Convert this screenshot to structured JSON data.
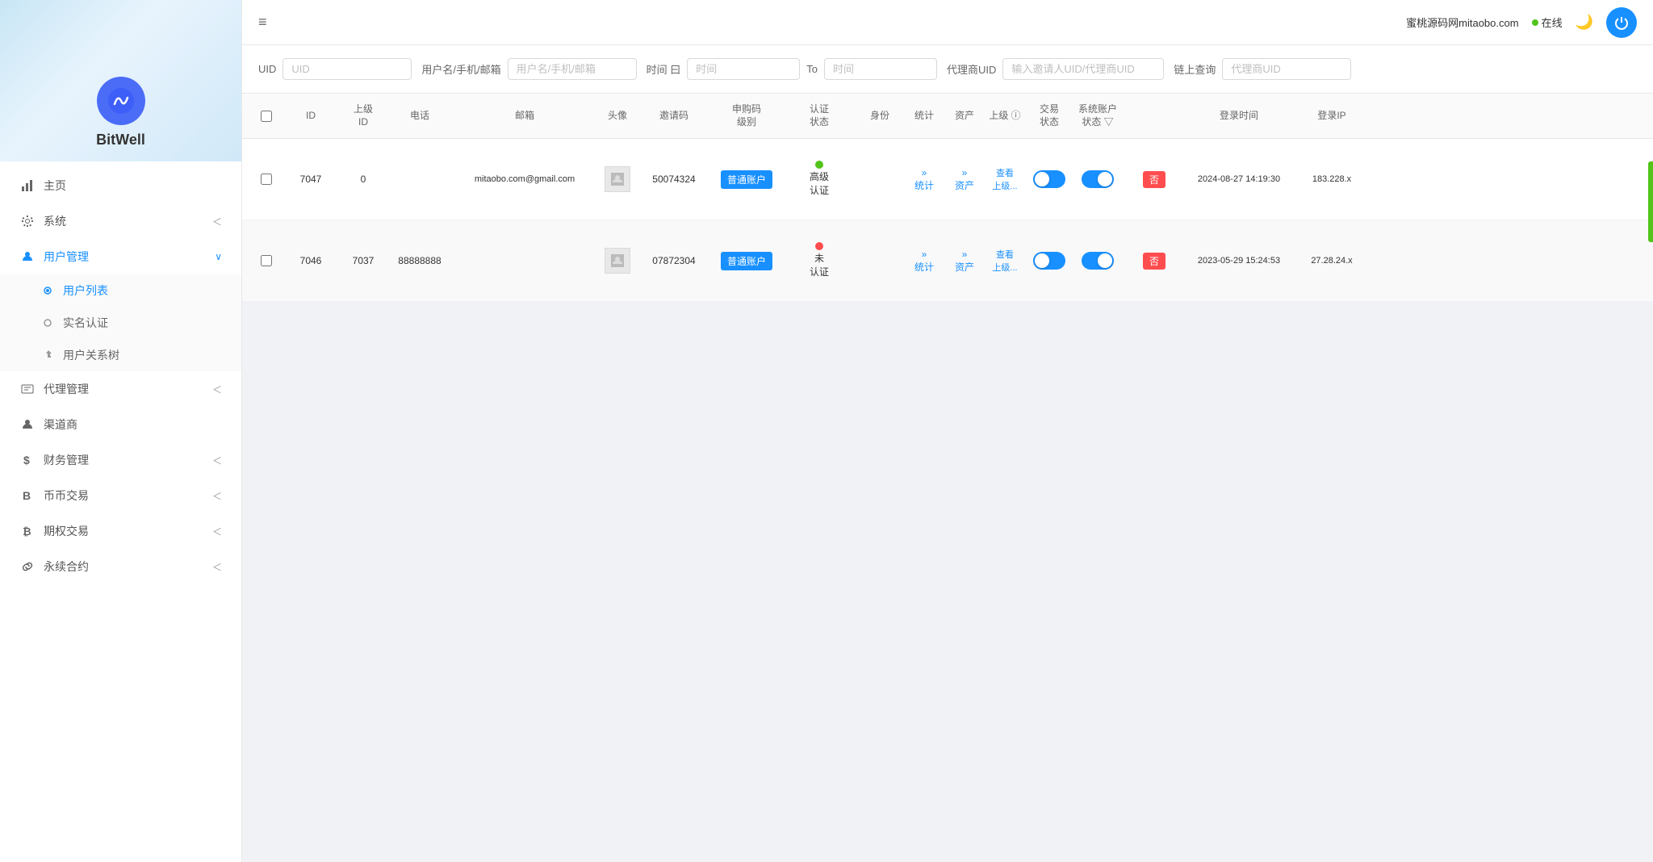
{
  "topbar": {
    "brand": "蜜桃源码网mitaobo.com",
    "online_text": "在线",
    "menu_toggle": "≡"
  },
  "sidebar": {
    "logo_text": "BitWell",
    "menu_items": [
      {
        "id": "home",
        "label": "主页",
        "icon": "bar-chart-icon",
        "arrow": ""
      },
      {
        "id": "system",
        "label": "系统",
        "icon": "gear-icon",
        "arrow": "<"
      },
      {
        "id": "user-mgmt",
        "label": "用户管理",
        "icon": "user-icon",
        "arrow": "∨",
        "expanded": true
      },
      {
        "id": "agent-mgmt",
        "label": "代理管理",
        "icon": "team-icon",
        "arrow": "<"
      },
      {
        "id": "channel",
        "label": "渠道商",
        "icon": "person-icon",
        "arrow": ""
      },
      {
        "id": "finance",
        "label": "财务管理",
        "icon": "dollar-icon",
        "arrow": "<"
      },
      {
        "id": "coin-trade",
        "label": "币币交易",
        "icon": "B-icon",
        "arrow": "<"
      },
      {
        "id": "options-trade",
        "label": "期权交易",
        "icon": "bitcoin-icon",
        "arrow": "<"
      },
      {
        "id": "perpetual",
        "label": "永续合约",
        "icon": "link-icon",
        "arrow": "<"
      }
    ],
    "submenu_items": [
      {
        "id": "user-list",
        "label": "用户列表",
        "active": true
      },
      {
        "id": "real-name",
        "label": "实名认证"
      },
      {
        "id": "user-tree",
        "label": "用户关系树"
      }
    ]
  },
  "filter": {
    "uid_label": "UID",
    "uid_placeholder": "UID",
    "username_label": "用户名/手机/邮箱",
    "username_placeholder": "用户名/手机/邮箱",
    "time_label": "时间 曰",
    "time_placeholder": "时间",
    "to_label": "To",
    "to_placeholder": "时间",
    "agent_uid_label": "代理商UID",
    "agent_uid_placeholder": "输入邀请人UID/代理商UID",
    "chain_query_label": "链上查询",
    "chain_query_placeholder": "代理商UID"
  },
  "table": {
    "headers": [
      "",
      "ID",
      "上级ID",
      "电话",
      "邮箱",
      "头像",
      "邀请码",
      "申购码 级别",
      "认证状态",
      "身份",
      "统计",
      "资产",
      "上级",
      "交易状态",
      "系统账户 状态",
      "登录时间",
      "登录IP"
    ],
    "rows": [
      {
        "id": "7047",
        "parent_id": "0",
        "phone": "",
        "email": "mitaobo.com@gmail.com",
        "invite_code": "50074324",
        "level": "普通账户",
        "cert_dot": "green",
        "cert_text": "高级认证",
        "identity": "",
        "stats": "»\n统计",
        "assets": "»\n资产",
        "superior": "查看上级...",
        "trade_status": "off",
        "system_status": "on",
        "no_badge": "否",
        "login_time": "2024-08-27 14:19:30",
        "login_ip": "183.228.x"
      },
      {
        "id": "7046",
        "parent_id": "7037",
        "phone": "88888888",
        "email": "",
        "invite_code": "07872304",
        "level": "普通账户",
        "cert_dot": "red",
        "cert_text": "未认证",
        "identity": "",
        "stats": "»\n统计",
        "assets": "»\n资产",
        "superior": "查看上级...",
        "trade_status": "off",
        "system_status": "on",
        "no_badge": "否",
        "login_time": "2023-05-29 15:24:53",
        "login_ip": "27.28.24.x"
      }
    ]
  }
}
